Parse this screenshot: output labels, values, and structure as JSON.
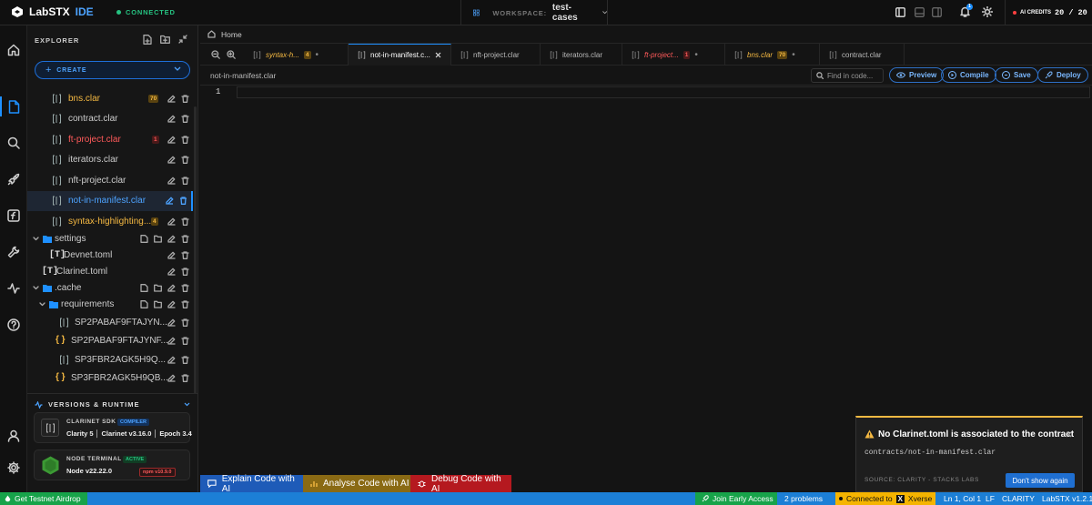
{
  "app": {
    "name": "LabSTX",
    "suffix": "IDE",
    "connection": "CONNECTED"
  },
  "workspace": {
    "label": "WORKSPACE:",
    "name": "test-cases"
  },
  "notifications": {
    "count": "1"
  },
  "ai_credits": {
    "label": "AI CREDITS",
    "value": "20 / 20"
  },
  "sidebar": {
    "title": "EXPLORER",
    "create_label": "CREATE",
    "files": [
      {
        "name": "bns.clar",
        "badge": "70",
        "state": "warn"
      },
      {
        "name": "contract.clar"
      },
      {
        "name": "ft-project.clar",
        "badge": "1",
        "state": "error"
      },
      {
        "name": "iterators.clar"
      },
      {
        "name": "nft-project.clar"
      },
      {
        "name": "not-in-manifest.clar",
        "state": "selected"
      },
      {
        "name": "syntax-highlighting...",
        "badge": "4",
        "state": "warn"
      }
    ],
    "settings_folder": "settings",
    "devnet": "Devnet.toml",
    "clarinet": "Clarinet.toml",
    "cache_folder": ".cache",
    "requirements_folder": "requirements",
    "requirements": [
      {
        "name": "SP2PABAF9FTAJYN...",
        "kind": "clar"
      },
      {
        "name": "SP2PABAF9FTAJYNF...",
        "kind": "json"
      },
      {
        "name": "SP3FBR2AGK5H9Q...",
        "kind": "clar"
      },
      {
        "name": "SP3FBR2AGK5H9QB...",
        "kind": "json"
      }
    ],
    "versions": {
      "title": "VERSIONS & RUNTIME",
      "sdk_title": "CLARINET SDK",
      "sdk_chip": "COMPILER",
      "sdk_value": "Clarity 5 │ Clarinet v3.16.0 │ Epoch 3.4",
      "node_title": "NODE TERMINAL",
      "node_chip": "ACTIVE",
      "node_value": "Node v22.22.0",
      "npm_value": "npm v10.9.0"
    }
  },
  "home_label": "Home",
  "tabs": [
    {
      "name": "syntax-h...",
      "badge": "4",
      "state": "warn"
    },
    {
      "name": "not-in-manifest.c...",
      "state": "active"
    },
    {
      "name": "nft-project.clar"
    },
    {
      "name": "iterators.clar"
    },
    {
      "name": "ft-project...",
      "badge": "1",
      "state": "error"
    },
    {
      "name": "bns.clar",
      "badge": "70",
      "state": "warn"
    },
    {
      "name": "contract.clar"
    }
  ],
  "editor": {
    "path": "not-in-manifest.clar",
    "find_placeholder": "Find in code...",
    "preview_label": "Preview",
    "compile_label": "Compile",
    "save_label": "Save",
    "deploy_label": "Deploy",
    "line_number": "1"
  },
  "ai_actions": {
    "explain": "Explain Code with AI",
    "analyse": "Analyse Code with AI",
    "debug": "Debug Code with AI"
  },
  "toast": {
    "title": "No Clarinet.toml is associated to the contract",
    "file": "contracts/not-in-manifest.clar",
    "source": "SOURCE: CLARITY - STACKS LABS",
    "dismiss": "Don't show again"
  },
  "status": {
    "airdrop": "Get Testnet Airdrop",
    "early_access": "Join Early Access",
    "problems": "2 problems",
    "connected_to": "Connected to",
    "xverse": "Xverse",
    "position": "Ln 1, Col 1",
    "eol": "LF",
    "language": "CLARITY",
    "version": "LabSTX v1.2.1"
  },
  "colors": {
    "accent": "#1e90ff",
    "warn": "#f5b942",
    "error": "#ff5a5a",
    "ok": "#26c281",
    "explain_bg": "#1e5bb8",
    "analyse_bg": "#8a6a14",
    "debug_bg": "#b5191f"
  }
}
